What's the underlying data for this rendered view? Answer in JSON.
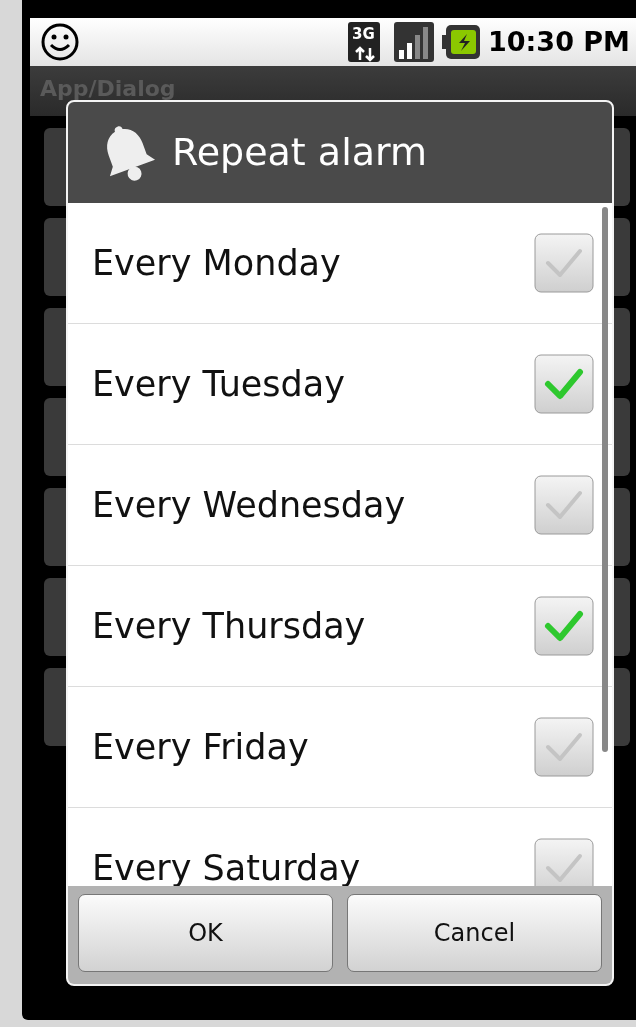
{
  "status_bar": {
    "time": "10:30 PM",
    "network": "3G"
  },
  "app_bar": {
    "title": "App/Dialog"
  },
  "dialog": {
    "title": "Repeat alarm",
    "items": [
      {
        "label": "Every Monday",
        "checked": false
      },
      {
        "label": "Every Tuesday",
        "checked": true
      },
      {
        "label": "Every Wednesday",
        "checked": false
      },
      {
        "label": "Every Thursday",
        "checked": true
      },
      {
        "label": "Every Friday",
        "checked": false
      },
      {
        "label": "Every Saturday",
        "checked": false
      }
    ],
    "buttons": [
      "OK",
      "Cancel"
    ]
  }
}
